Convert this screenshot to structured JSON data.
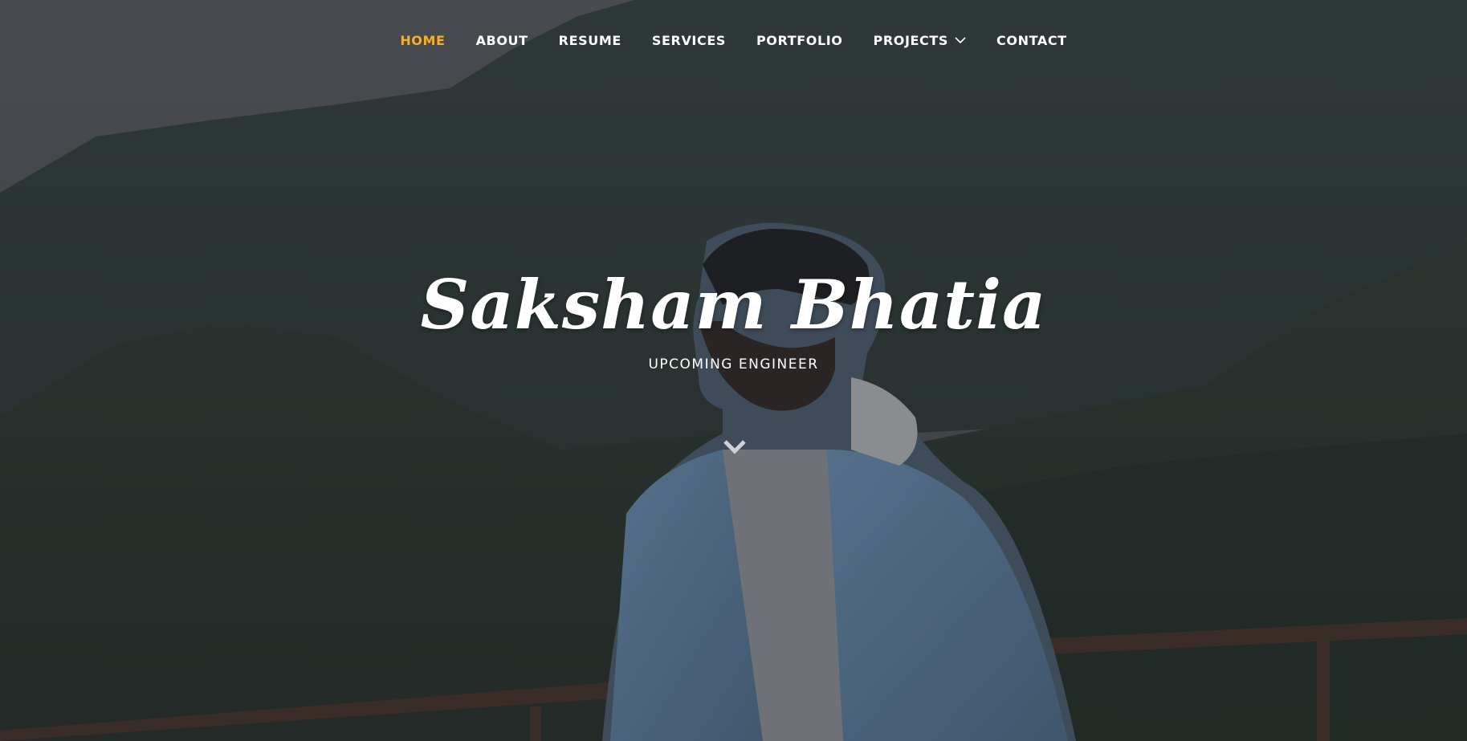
{
  "nav": {
    "items": [
      {
        "label": "HOME",
        "active": true
      },
      {
        "label": "ABOUT"
      },
      {
        "label": "RESUME"
      },
      {
        "label": "SERVICES"
      },
      {
        "label": "PORTFOLIO"
      },
      {
        "label": "PROJECTS",
        "has_dropdown": true
      },
      {
        "label": "CONTACT"
      }
    ]
  },
  "hero": {
    "name": "Saksham Bhatia",
    "tagline": "UPCOMING ENGINEER",
    "background": "mountain-landscape-photo",
    "scroll_icon": "chevron-down-icon"
  },
  "colors": {
    "accent": "#f5b027",
    "text": "#ffffff",
    "overlay": "#2b3036"
  }
}
